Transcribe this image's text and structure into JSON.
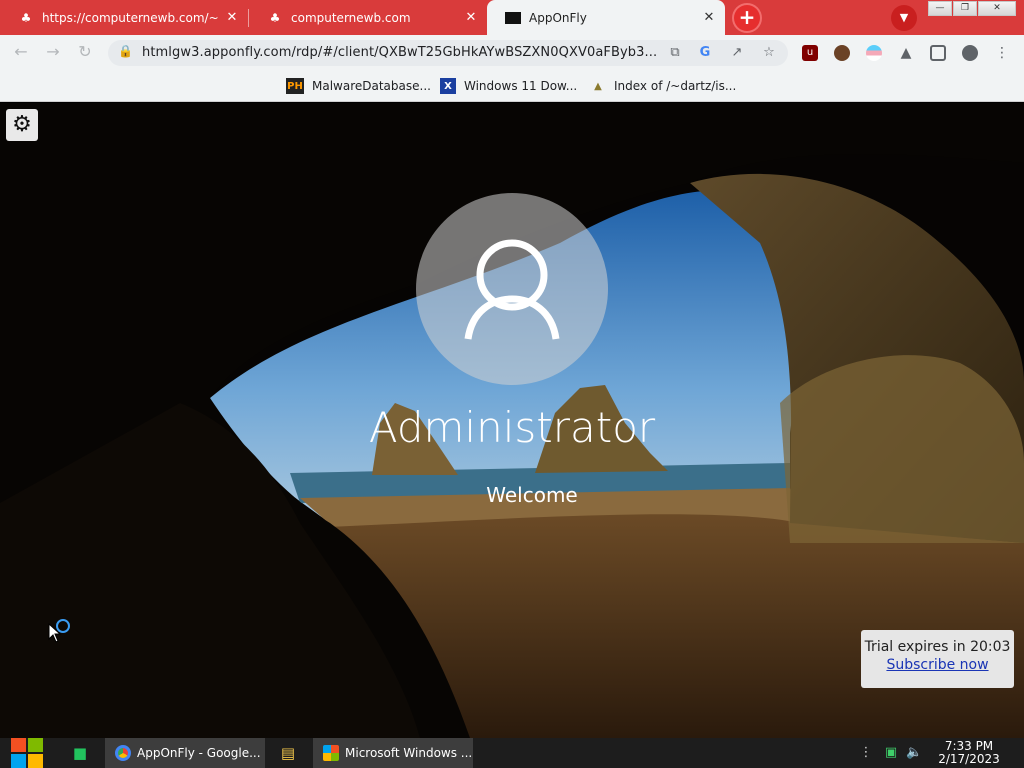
{
  "browser": {
    "tabs": [
      {
        "title": "https://computernewb.com/~lily",
        "state": "inactive"
      },
      {
        "title": "computernewb.com",
        "state": "inactive"
      },
      {
        "title": "AppOnFly",
        "state": "active"
      }
    ],
    "new_tab_label": "+",
    "url": "htmlgw3.apponfly.com/rdp/#/client/QXBwT25GbHkAYwBSZXN0QXV0aFByb3...",
    "accent_color": "#d93b3b"
  },
  "bookmarks": [
    {
      "label": "MalwareDatabase..."
    },
    {
      "label": "Windows 11 Dow..."
    },
    {
      "label": "Index of /~dartz/is..."
    }
  ],
  "remote": {
    "username": "Administrator",
    "status": "Welcome",
    "trial_text": "Trial expires in 20:03",
    "subscribe_label": "Subscribe now"
  },
  "taskbar": {
    "items": [
      {
        "label": "AppOnFly - Google..."
      },
      {
        "label": "Microsoft Windows ..."
      }
    ],
    "time": "7:33 PM",
    "date": "2/17/2023"
  }
}
